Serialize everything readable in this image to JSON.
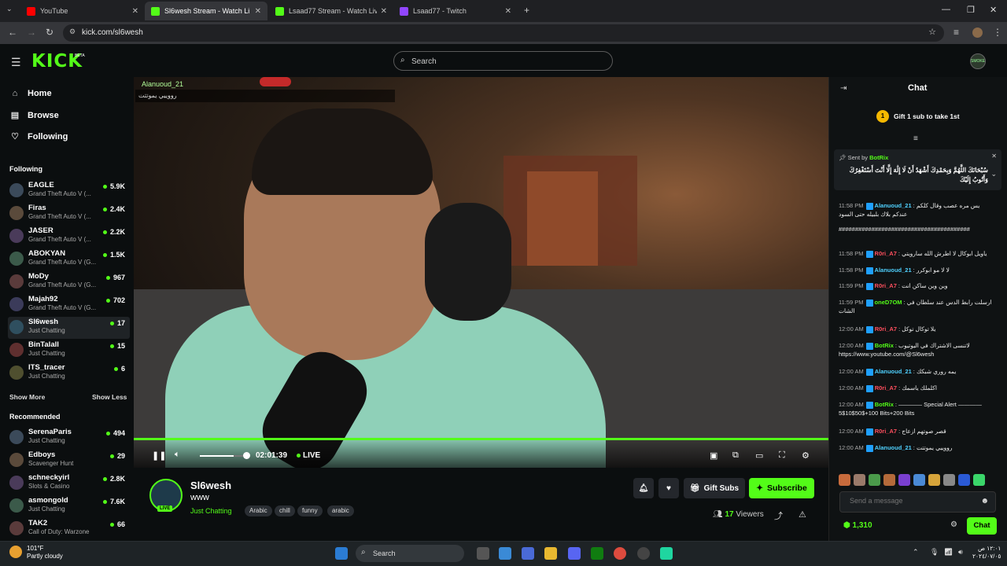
{
  "browser": {
    "tabs": [
      {
        "label": "YouTube",
        "color": "#ff0000"
      },
      {
        "label": "Sl6wesh Stream - Watch Live",
        "color": "#53fc18"
      },
      {
        "label": "Lsaad77 Stream - Watch Live o",
        "color": "#53fc18"
      },
      {
        "label": "Lsaad77 - Twitch",
        "color": "#9146ff"
      }
    ],
    "url": "kick.com/sl6wesh"
  },
  "header": {
    "logo": "KICK",
    "beta": "BETA",
    "search_placeholder": "Search",
    "avatar_text": "SMOKE"
  },
  "sidebar": {
    "nav": [
      {
        "label": "Home",
        "icon": "home-icon"
      },
      {
        "label": "Browse",
        "icon": "browse-icon"
      },
      {
        "label": "Following",
        "icon": "heart-icon"
      }
    ],
    "following_title": "Following",
    "following": [
      {
        "name": "EAGLE",
        "category": "Grand Theft Auto V (...",
        "viewers": "5.9K"
      },
      {
        "name": "Firas",
        "category": "Grand Theft Auto V (...",
        "viewers": "2.4K"
      },
      {
        "name": "JASER",
        "category": "Grand Theft Auto V (...",
        "viewers": "2.2K"
      },
      {
        "name": "ABOKYAN",
        "category": "Grand Theft Auto V (G...",
        "viewers": "1.5K"
      },
      {
        "name": "MoDy",
        "category": "Grand Theft Auto V (G...",
        "viewers": "967"
      },
      {
        "name": "Majah92",
        "category": "Grand Theft Auto V (G...",
        "viewers": "702"
      },
      {
        "name": "Sl6wesh",
        "category": "Just Chatting",
        "viewers": "17"
      },
      {
        "name": "BinTalall",
        "category": "Just Chatting",
        "viewers": "15"
      },
      {
        "name": "ITS_tracer",
        "category": "Just Chatting",
        "viewers": "6"
      }
    ],
    "show_more": "Show More",
    "show_less": "Show Less",
    "recommended_title": "Recommended",
    "recommended": [
      {
        "name": "SerenaParis",
        "category": "Just Chatting",
        "viewers": "494"
      },
      {
        "name": "Edboys",
        "category": "Scavenger Hunt",
        "viewers": "29"
      },
      {
        "name": "schneckyirl",
        "category": "Slots & Casino",
        "viewers": "2.8K"
      },
      {
        "name": "asmongold",
        "category": "Just Chatting",
        "viewers": "7.6K"
      },
      {
        "name": "TAK2",
        "category": "Call of Duty: Warzone",
        "viewers": "66"
      }
    ]
  },
  "player": {
    "overlay_user": "Alanuoud_21",
    "overlay_text": "رووييي يموتتت",
    "time": "02:01:39",
    "live_label": "LIVE",
    "volume_percent": 70
  },
  "stream": {
    "streamer": "Sl6wesh",
    "title": "www",
    "category": "Just Chatting",
    "tags": [
      "Arabic",
      "chill",
      "funny",
      "arabic"
    ],
    "live_badge": "LIVE",
    "gift_subs": "Gift Subs",
    "subscribe": "Subscribe",
    "viewers_count": "17",
    "viewers_label": "Viewers"
  },
  "chat": {
    "title": "Chat",
    "gift_banner": "Gift 1 sub to take 1st",
    "gift_rank": "1",
    "pinned_prefix": "Sent by",
    "pinned_user": "BotRix",
    "pinned_text": "سُبْحَانَكَ اللَّهُمَّ وَبِحَمْدِكَ أَشْهَدُ أَنْ لَا إِلَٰهَ إِلَّا أَنْتَ أَسْتَغْفِرُكَ وَأَتُوبُ إِلَيْكَ",
    "messages": [
      {
        "time": "11:58 PM",
        "user": "Alanuoud_21",
        "color": "#4fd1ff",
        "text": "يس مره عصب وقال كلكم عندكم بلاك بلبيله حتى السود"
      },
      {
        "time": "",
        "user": "",
        "color": "#ffffff",
        "text": "########################################"
      },
      {
        "time": "11:58 PM",
        "user": "R0ri_A7",
        "color": "#ff4f5e",
        "text": "ياويل ابوكال لا اطرش الله سارويتي"
      },
      {
        "time": "11:58 PM",
        "user": "Alanuoud_21",
        "color": "#4fd1ff",
        "text": "لا لا مو ابوكرر"
      },
      {
        "time": "11:59 PM",
        "user": "R0ri_A7",
        "color": "#ff4f5e",
        "text": "وين وين ساكن انت"
      },
      {
        "time": "11:59 PM",
        "user": "oneD7OM",
        "color": "#53fc18",
        "text": "ارسلت رابط الدس عند سلطان في الشات"
      },
      {
        "time": "12:00 AM",
        "user": "R0ri_A7",
        "color": "#ff4f5e",
        "text": "يلا توكال توكل"
      },
      {
        "time": "12:00 AM",
        "user": "BotRix",
        "color": "#53fc18",
        "text": "لاتنسى الاشتراك في اليوتيوب https://www.youtube.com/@Sl6wesh"
      },
      {
        "time": "12:00 AM",
        "user": "Alanuoud_21",
        "color": "#4fd1ff",
        "text": "يمه روري شبكك"
      },
      {
        "time": "12:00 AM",
        "user": "R0ri_A7",
        "color": "#ff4f5e",
        "text": "اكلملك ياسمك"
      },
      {
        "time": "12:00 AM",
        "user": "BotRix",
        "color": "#53fc18",
        "text": "———— Special Alert ————5$10$50$+100 Bits+200 Bits"
      },
      {
        "time": "12:00 AM",
        "user": "R0ri_A7",
        "color": "#ff4f5e",
        "text": "قصر صوتهم ازعاج"
      },
      {
        "time": "12:00 AM",
        "user": "Alanuoud_21",
        "color": "#4fd1ff",
        "text": "رووييي يموتتت"
      }
    ],
    "input_placeholder": "Send a message",
    "points": "1,310",
    "chat_button": "Chat"
  },
  "taskbar": {
    "temp": "101°F",
    "weather": "Partly cloudy",
    "search": "Search",
    "time": "١٢:٠١ ص",
    "date": "٢٠٢٤/٠٧/٠٥"
  },
  "colors": {
    "accent": "#53fc18",
    "background": "#0b0e0f"
  }
}
